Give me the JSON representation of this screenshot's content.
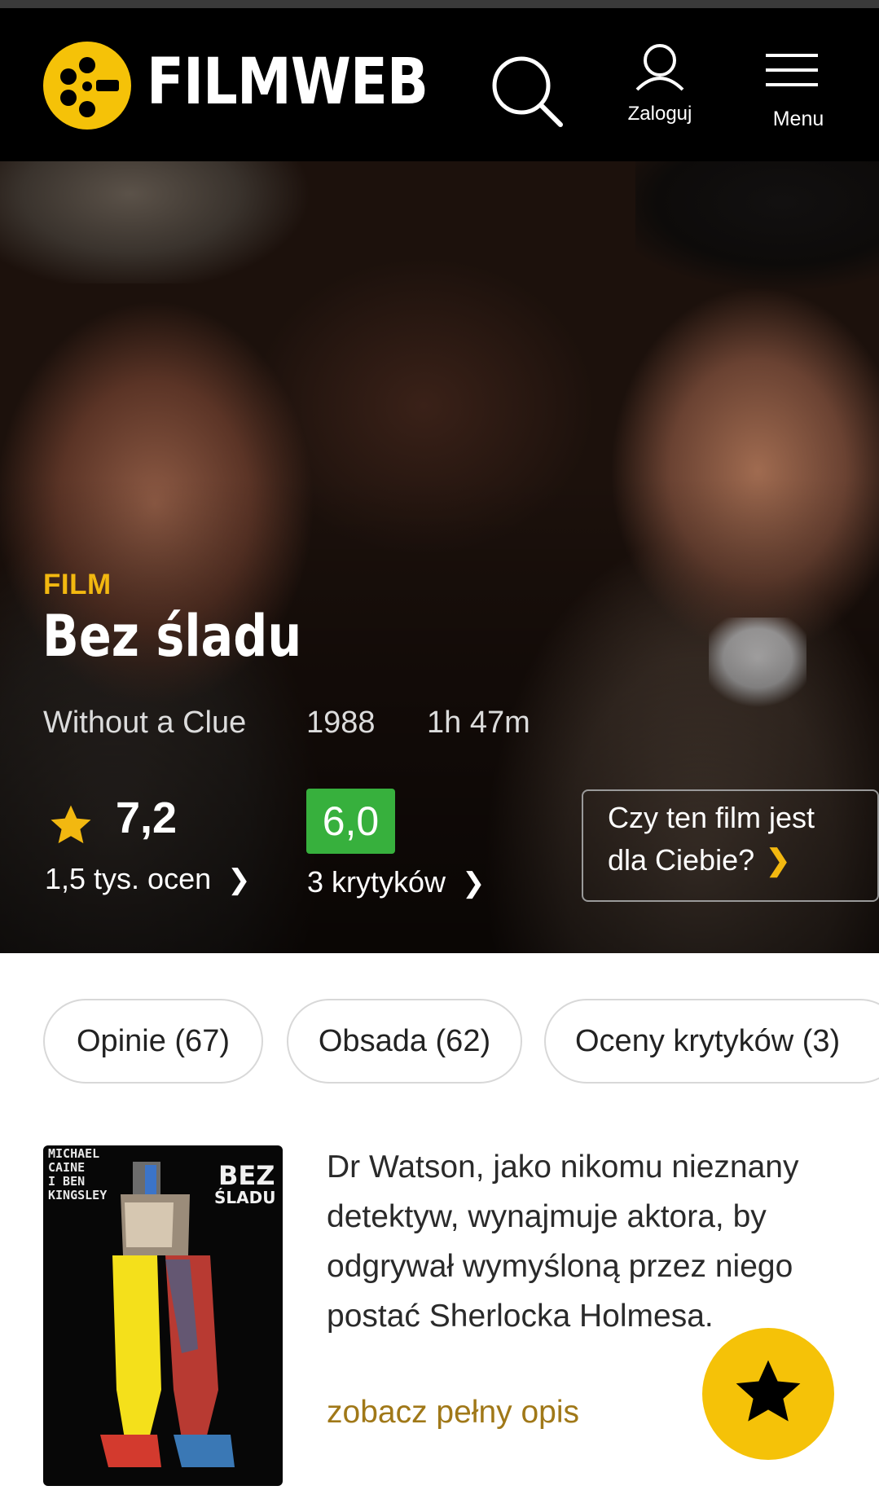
{
  "header": {
    "brand": "FILMWEB",
    "login_label": "Zaloguj",
    "menu_label": "Menu"
  },
  "movie": {
    "kind": "FILM",
    "title": "Bez śladu",
    "original_title": "Without a Clue",
    "year": "1988",
    "duration": "1h 47m",
    "rating": "7,2",
    "rating_count": "1,5 tys.  ocen",
    "critic_rating": "6,0",
    "critic_count": "3 krytyków",
    "for_you_line1": "Czy ten film jest",
    "for_you_line2": "dla Ciebie?"
  },
  "tabs": [
    {
      "label": "Opinie (67)"
    },
    {
      "label": "Obsada (62)"
    },
    {
      "label": "Oceny krytyków (3)"
    }
  ],
  "poster": {
    "credits": "MICHAEL\nCAINE\nI BEN\nKINGSLEY",
    "title": "BEZ",
    "subtitle": "ŚLADU"
  },
  "description": {
    "text": "Dr Watson, jako nikomu nieznany detektyw, wynajmuje aktora, by odgrywał wymyśloną przez niego postać Sherlocka Holmesa.",
    "more_link": "zobacz pełny opis"
  },
  "colors": {
    "accent": "#f2b810",
    "critic_green": "#37b03d",
    "link_gold": "#a07818"
  },
  "icons": {
    "logo": "filmweb-reel-icon",
    "search": "search-icon",
    "user": "user-icon",
    "menu": "hamburger-icon",
    "star": "star-icon",
    "fab": "star-icon"
  }
}
